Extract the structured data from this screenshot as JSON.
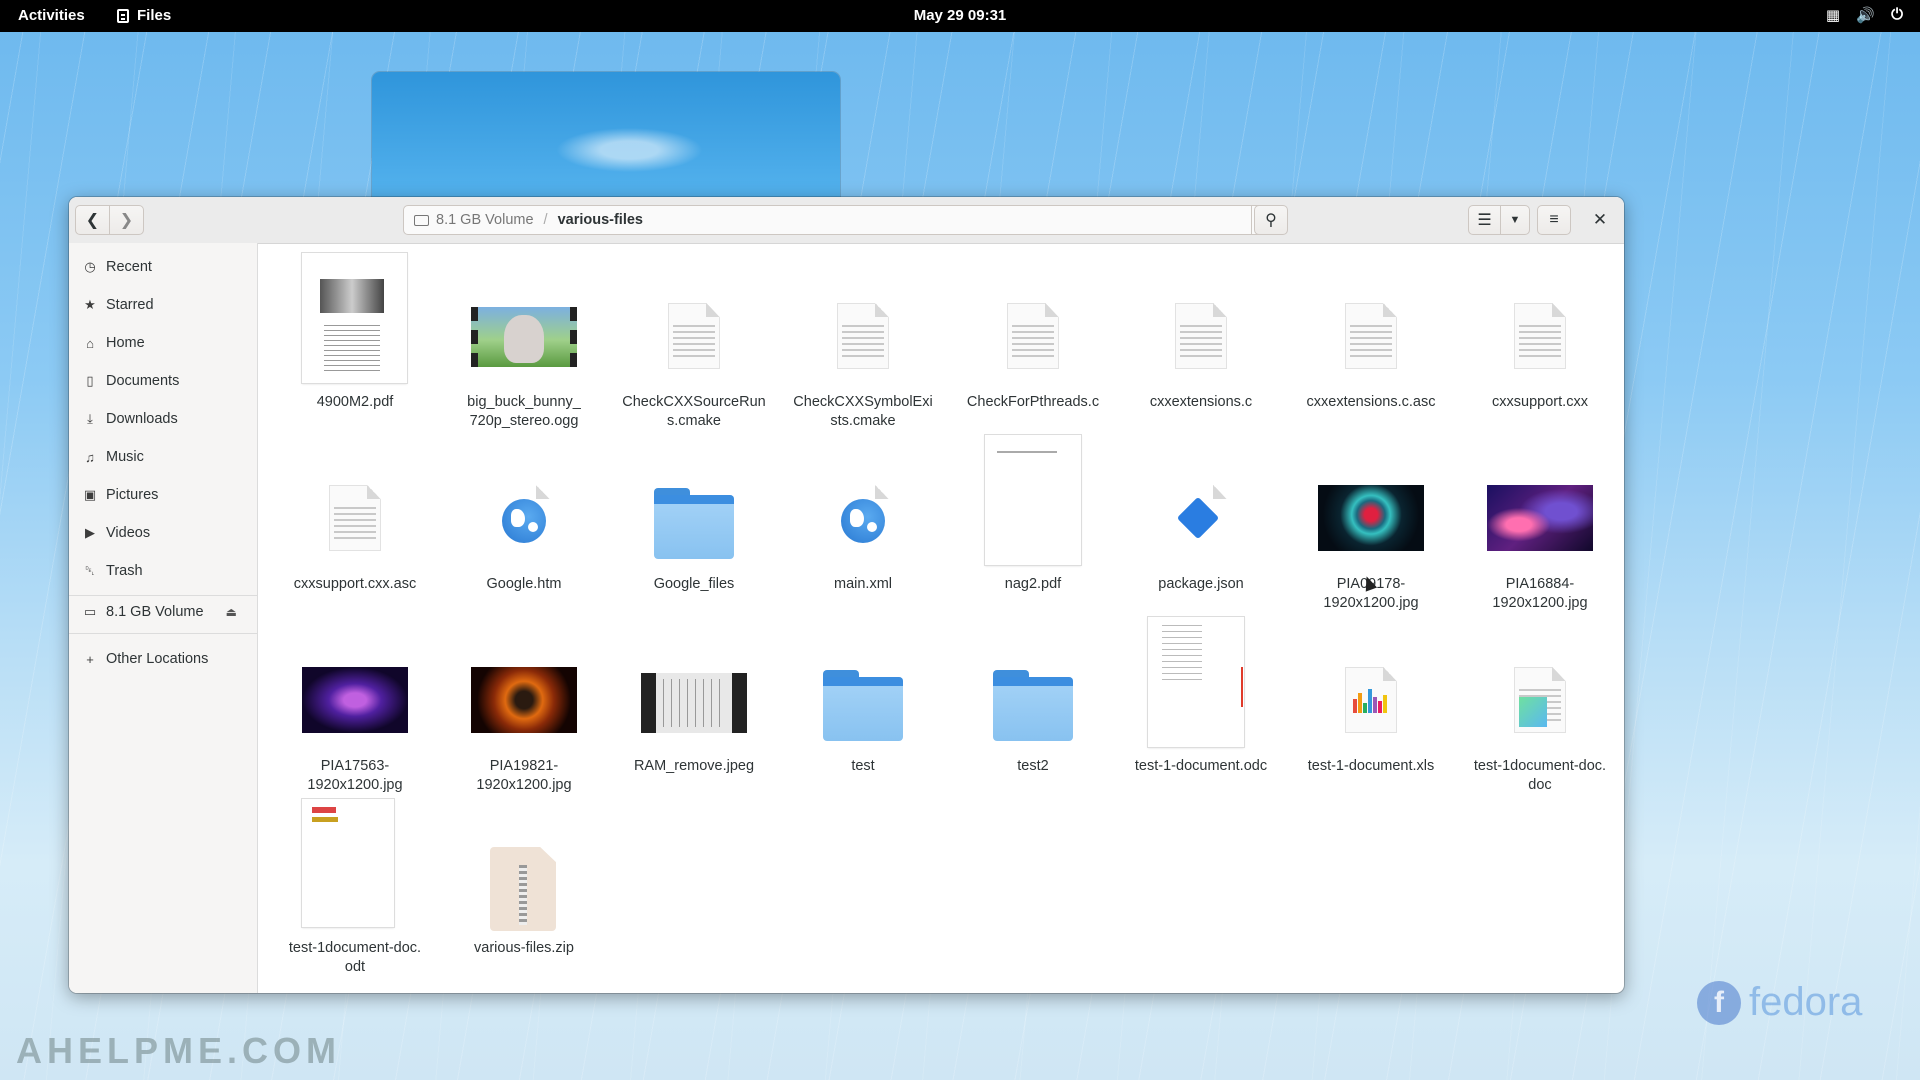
{
  "topbar": {
    "activities": "Activities",
    "app": "Files",
    "clock": "May 29  09:31"
  },
  "window": {
    "path": {
      "root": "8.1 GB Volume",
      "separator": "/",
      "current": "various-files"
    }
  },
  "sidebar": {
    "items": [
      {
        "label": "Recent",
        "icon": "clock-icon"
      },
      {
        "label": "Starred",
        "icon": "star-icon"
      },
      {
        "label": "Home",
        "icon": "home-icon"
      },
      {
        "label": "Documents",
        "icon": "document-icon"
      },
      {
        "label": "Downloads",
        "icon": "download-icon"
      },
      {
        "label": "Music",
        "icon": "music-icon"
      },
      {
        "label": "Pictures",
        "icon": "pictures-icon"
      },
      {
        "label": "Videos",
        "icon": "video-icon"
      },
      {
        "label": "Trash",
        "icon": "trash-icon"
      }
    ],
    "volume": "8.1 GB Volume",
    "other": "Other Locations"
  },
  "files": [
    {
      "name": "4900M2.pdf",
      "kind": "pdf-thumb"
    },
    {
      "name": "big_buck_bunny_\n720p_stereo.ogg",
      "kind": "video-thumb"
    },
    {
      "name": "CheckCXXSourceRun\ns.cmake",
      "kind": "text"
    },
    {
      "name": "CheckCXXSymbolExi\nsts.cmake",
      "kind": "text"
    },
    {
      "name": "CheckForPthreads.c",
      "kind": "text"
    },
    {
      "name": "cxxextensions.c",
      "kind": "text"
    },
    {
      "name": "cxxextensions.c.asc",
      "kind": "text"
    },
    {
      "name": "cxxsupport.cxx",
      "kind": "text"
    },
    {
      "name": "cxxsupport.cxx.asc",
      "kind": "text"
    },
    {
      "name": "Google.htm",
      "kind": "html"
    },
    {
      "name": "Google_files",
      "kind": "folder"
    },
    {
      "name": "main.xml",
      "kind": "html"
    },
    {
      "name": "nag2.pdf",
      "kind": "pdf-page"
    },
    {
      "name": "package.json",
      "kind": "json"
    },
    {
      "name": "PIA09178-\n1920x1200.jpg",
      "kind": "image-helix"
    },
    {
      "name": "PIA16884-\n1920x1200.jpg",
      "kind": "image-nebula"
    },
    {
      "name": "PIA17563-\n1920x1200.jpg",
      "kind": "image-purple"
    },
    {
      "name": "PIA19821-\n1920x1200.jpg",
      "kind": "image-orange"
    },
    {
      "name": "RAM_remove.jpeg",
      "kind": "image-ram"
    },
    {
      "name": "test",
      "kind": "folder"
    },
    {
      "name": "test2",
      "kind": "folder"
    },
    {
      "name": "test-1-document.odc",
      "kind": "odc-page"
    },
    {
      "name": "test-1-document.xls",
      "kind": "xls"
    },
    {
      "name": "test-1document-doc.\ndoc",
      "kind": "doc"
    },
    {
      "name": "test-1document-doc.\nodt",
      "kind": "odt-page"
    },
    {
      "name": "various-files.zip",
      "kind": "zip"
    }
  ],
  "overlay": {
    "watermark": "AHELPME.COM",
    "brand": "fedora"
  }
}
